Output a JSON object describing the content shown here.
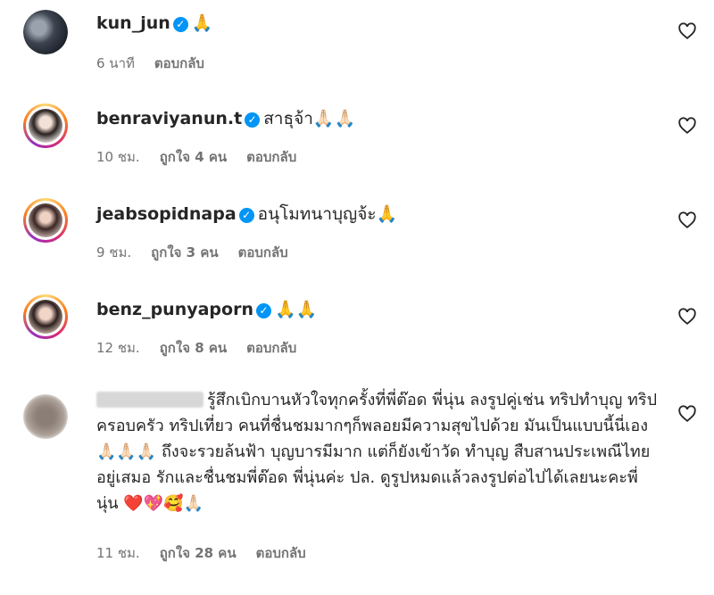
{
  "comments": [
    {
      "username": "kun_jun",
      "verified": true,
      "text": "🙏",
      "time": "6 นาที",
      "likes": "",
      "reply": "ตอบกลับ"
    },
    {
      "username": "benraviyanun.t",
      "verified": true,
      "text": "สาธุจ้า🙏🏻🙏🏻",
      "time": "10 ชม.",
      "likes": "ถูกใจ 4 คน",
      "reply": "ตอบกลับ"
    },
    {
      "username": "jeabsopidnapa",
      "verified": true,
      "text": "อนุโมทนาบุญจ้ะ🙏",
      "time": "9 ชม.",
      "likes": "ถูกใจ 3 คน",
      "reply": "ตอบกลับ"
    },
    {
      "username": "benz_punyaporn",
      "verified": true,
      "text": "🙏🙏",
      "time": "12 ชม.",
      "likes": "ถูกใจ 8 คน",
      "reply": "ตอบกลับ"
    },
    {
      "username": "",
      "verified": false,
      "text": "รู้สึกเบิกบานหัวใจทุกครั้งที่พี่ต๊อด พี่นุ่น ลงรูปคู่เช่น ทริปทำบุญ ทริปครอบครัว ทริปเที่ยว คนที่ชื่นชมมากๆก็พลอยมีความสุขไปด้วย มันเป็นแบบนี้นี่เอง 🙏🏻🙏🏻🙏🏻 ถึงจะรวยล้นฟ้า บุญบารมีมาก แต่ก็ยังเข้าวัด ทำบุญ สืบสานประเพณีไทยอยู่เสมอ รักและชื่นชมพี่ต๊อด พี่นุ่นค่ะ ปล. ดูรูปหมดแล้วลงรูปต่อไปได้เลยนะคะพี่นุ่น ❤️💖🥰🙏🏻",
      "time": "11 ชม.",
      "likes": "ถูกใจ 28 คน",
      "reply": "ตอบกลับ"
    }
  ],
  "icons": {
    "verified": "verified-badge-icon",
    "like": "heart-outline-icon"
  },
  "colors": {
    "verified": "#0095f6",
    "meta": "#737373",
    "text": "#262626"
  }
}
